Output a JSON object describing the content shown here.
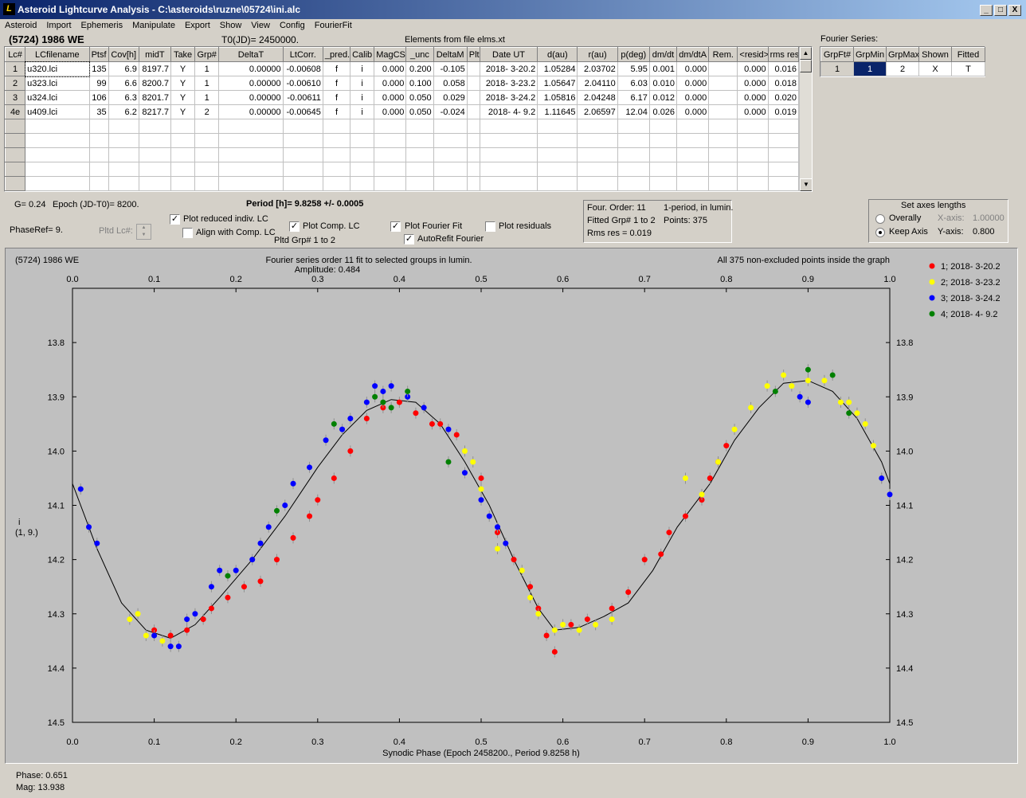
{
  "window": {
    "title": "Asteroid Lightcurve Analysis - C:\\asteroids\\ruzne\\05724\\ini.alc",
    "icon": "app-icon",
    "min": "_",
    "max": "□",
    "close": "X"
  },
  "menu": [
    "Asteroid",
    "Import",
    "Ephemeris",
    "Manipulate",
    "Export",
    "Show",
    "View",
    "Config",
    "FourierFit"
  ],
  "asteroid_name": "(5724) 1986 WE",
  "t0": "T0(JD)= 2450000.",
  "elements_note": "Elements from file elms.xt",
  "lc_table": {
    "headers": [
      "Lc#",
      "LCfilename",
      "Ptsf",
      "Cov[h]",
      "midT",
      "Take",
      "Grp#",
      "DeltaT",
      "LtCorr.",
      "_pred.",
      "Calib",
      "MagCS",
      "_unc",
      "DeltaM",
      "Plt",
      "Date UT",
      "d(au)",
      "r(au)",
      "p(deg)",
      "dm/dt",
      "dm/dtA",
      "Rem.",
      "<resid>",
      "rms res"
    ],
    "rows": [
      [
        "1",
        "u320.lci",
        "135",
        "6.9",
        "8197.7",
        "Y",
        "1",
        "0.00000",
        "-0.00608",
        "f",
        "i",
        "0.000",
        "0.200",
        "-0.105",
        "",
        "2018- 3-20.2",
        "1.05284",
        "2.03702",
        "5.95",
        "0.001",
        "0.000",
        "",
        "0.000",
        "0.016"
      ],
      [
        "2",
        "u323.lci",
        "99",
        "6.6",
        "8200.7",
        "Y",
        "1",
        "0.00000",
        "-0.00610",
        "f",
        "i",
        "0.000",
        "0.100",
        "0.058",
        "",
        "2018- 3-23.2",
        "1.05647",
        "2.04110",
        "6.03",
        "0.010",
        "0.000",
        "",
        "0.000",
        "0.018"
      ],
      [
        "3",
        "u324.lci",
        "106",
        "6.3",
        "8201.7",
        "Y",
        "1",
        "0.00000",
        "-0.00611",
        "f",
        "i",
        "0.000",
        "0.050",
        "0.029",
        "",
        "2018- 3-24.2",
        "1.05816",
        "2.04248",
        "6.17",
        "0.012",
        "0.000",
        "",
        "0.000",
        "0.020"
      ],
      [
        "4e",
        "u409.lci",
        "35",
        "6.2",
        "8217.7",
        "Y",
        "2",
        "0.00000",
        "-0.00645",
        "f",
        "i",
        "0.000",
        "0.050",
        "-0.024",
        "",
        "2018- 4- 9.2",
        "1.11645",
        "2.06597",
        "12.04",
        "0.026",
        "0.000",
        "",
        "0.000",
        "0.019"
      ]
    ]
  },
  "fourier_series": {
    "label": "Fourier Series:",
    "headers": [
      "GrpFt#",
      "GrpMin",
      "GrpMax",
      "Shown",
      "Fitted"
    ],
    "row": [
      "1",
      "1",
      "2",
      "X",
      "T"
    ]
  },
  "params": {
    "g": "G= 0.24",
    "epoch": "Epoch (JD-T0)= 8200.",
    "period": "Period [h]= 9.8258 +/- 0.0005",
    "phase_ref": "PhaseRef= 9.",
    "pltd_lc": "Pltd Lc#:",
    "pltd_grp": "Pltd Grp#  1   to   2"
  },
  "checkboxes": {
    "plot_reduced": {
      "label": "Plot reduced indiv. LC",
      "checked": true
    },
    "align_comp": {
      "label": "Align with Comp. LC",
      "checked": false
    },
    "plot_comp": {
      "label": "Plot Comp. LC",
      "checked": true
    },
    "plot_fourier": {
      "label": "Plot Fourier Fit",
      "checked": true
    },
    "plot_residuals": {
      "label": "Plot residuals",
      "checked": false
    },
    "autorefit": {
      "label": "AutoRefit Fourier",
      "checked": true
    }
  },
  "fit_info": {
    "order": "Four. Order: 11",
    "mode": "1-period, in lumin.",
    "fitted": "Fitted Grp# 1 to 2",
    "points": "Points: 375",
    "rms": "Rms res     = 0.019"
  },
  "axes_box": {
    "title": "Set axes lengths",
    "overally": "Overally",
    "keep_axis": "Keep Axis",
    "x_label": "X-axis:",
    "x_value": "1.00000",
    "y_label": "Y-axis:",
    "y_value": "0.800",
    "selected": "keep_axis"
  },
  "plot_header": {
    "left": "(5724) 1986 WE",
    "center1": "Fourier series order 11 fit to selected groups in lumin.",
    "center2": "Amplitude: 0.484",
    "right": "All 375 non-excluded points inside the graph"
  },
  "legend": [
    {
      "label": "1; 2018- 3-20.2",
      "color": "#ff0000"
    },
    {
      "label": "2; 2018- 3-23.2",
      "color": "#ffff00"
    },
    {
      "label": "3; 2018- 3-24.2",
      "color": "#0000ff"
    },
    {
      "label": "4; 2018- 4- 9.2",
      "color": "#008000"
    }
  ],
  "status": {
    "phase": "Phase:  0.651",
    "mag": "Mag:    13.938"
  },
  "chart_data": {
    "type": "scatter",
    "xlabel": "Synodic Phase (Epoch 2458200., Period 9.8258 h)",
    "ylabel_lines": [
      "i",
      "(1, 9.)"
    ],
    "xlim": [
      0.0,
      1.0
    ],
    "ylim": [
      14.5,
      13.7
    ],
    "inverted_y": true,
    "x_ticks": [
      "0.0",
      "0.1",
      "0.2",
      "0.3",
      "0.4",
      "0.5",
      "0.6",
      "0.7",
      "0.8",
      "0.9",
      "1.0"
    ],
    "y_ticks": [
      "13.8",
      "13.9",
      "14.0",
      "14.1",
      "14.2",
      "14.3",
      "14.4",
      "14.5"
    ],
    "fit_curve": [
      [
        0.0,
        14.06
      ],
      [
        0.03,
        14.18
      ],
      [
        0.06,
        14.28
      ],
      [
        0.09,
        14.33
      ],
      [
        0.12,
        14.345
      ],
      [
        0.15,
        14.32
      ],
      [
        0.18,
        14.27
      ],
      [
        0.22,
        14.2
      ],
      [
        0.26,
        14.12
      ],
      [
        0.3,
        14.03
      ],
      [
        0.33,
        13.97
      ],
      [
        0.36,
        13.925
      ],
      [
        0.39,
        13.905
      ],
      [
        0.42,
        13.91
      ],
      [
        0.45,
        13.95
      ],
      [
        0.48,
        14.02
      ],
      [
        0.51,
        14.1
      ],
      [
        0.54,
        14.2
      ],
      [
        0.57,
        14.29
      ],
      [
        0.59,
        14.33
      ],
      [
        0.62,
        14.325
      ],
      [
        0.65,
        14.305
      ],
      [
        0.68,
        14.28
      ],
      [
        0.71,
        14.22
      ],
      [
        0.74,
        14.14
      ],
      [
        0.78,
        14.06
      ],
      [
        0.81,
        13.98
      ],
      [
        0.84,
        13.92
      ],
      [
        0.87,
        13.875
      ],
      [
        0.9,
        13.87
      ],
      [
        0.93,
        13.89
      ],
      [
        0.96,
        13.94
      ],
      [
        0.99,
        14.02
      ],
      [
        1.0,
        14.06
      ]
    ],
    "series": [
      {
        "name": "1; 2018- 3-20.2",
        "color": "#ff0000",
        "points": [
          [
            0.1,
            14.33
          ],
          [
            0.12,
            14.34
          ],
          [
            0.14,
            14.33
          ],
          [
            0.16,
            14.31
          ],
          [
            0.17,
            14.29
          ],
          [
            0.19,
            14.27
          ],
          [
            0.21,
            14.25
          ],
          [
            0.23,
            14.24
          ],
          [
            0.25,
            14.2
          ],
          [
            0.27,
            14.16
          ],
          [
            0.29,
            14.12
          ],
          [
            0.3,
            14.09
          ],
          [
            0.32,
            14.05
          ],
          [
            0.34,
            14.0
          ],
          [
            0.36,
            13.94
          ],
          [
            0.38,
            13.92
          ],
          [
            0.4,
            13.91
          ],
          [
            0.42,
            13.93
          ],
          [
            0.44,
            13.95
          ],
          [
            0.45,
            13.95
          ],
          [
            0.47,
            13.97
          ],
          [
            0.5,
            14.05
          ],
          [
            0.52,
            14.15
          ],
          [
            0.54,
            14.2
          ],
          [
            0.56,
            14.25
          ],
          [
            0.57,
            14.29
          ],
          [
            0.58,
            14.34
          ],
          [
            0.59,
            14.37
          ],
          [
            0.61,
            14.32
          ],
          [
            0.63,
            14.31
          ],
          [
            0.66,
            14.29
          ],
          [
            0.68,
            14.26
          ],
          [
            0.7,
            14.2
          ],
          [
            0.72,
            14.19
          ],
          [
            0.73,
            14.15
          ],
          [
            0.75,
            14.12
          ],
          [
            0.77,
            14.09
          ],
          [
            0.78,
            14.05
          ],
          [
            0.79,
            14.02
          ],
          [
            0.8,
            13.99
          ]
        ]
      },
      {
        "name": "2; 2018- 3-23.2",
        "color": "#ffff00",
        "points": [
          [
            0.07,
            14.31
          ],
          [
            0.08,
            14.3
          ],
          [
            0.09,
            14.34
          ],
          [
            0.11,
            14.35
          ],
          [
            0.48,
            14.0
          ],
          [
            0.49,
            14.02
          ],
          [
            0.5,
            14.07
          ],
          [
            0.52,
            14.18
          ],
          [
            0.55,
            14.22
          ],
          [
            0.56,
            14.27
          ],
          [
            0.57,
            14.3
          ],
          [
            0.59,
            14.33
          ],
          [
            0.6,
            14.32
          ],
          [
            0.62,
            14.33
          ],
          [
            0.64,
            14.32
          ],
          [
            0.66,
            14.31
          ],
          [
            0.75,
            14.05
          ],
          [
            0.77,
            14.08
          ],
          [
            0.79,
            14.02
          ],
          [
            0.81,
            13.96
          ],
          [
            0.83,
            13.92
          ],
          [
            0.85,
            13.88
          ],
          [
            0.87,
            13.86
          ],
          [
            0.88,
            13.88
          ],
          [
            0.9,
            13.87
          ],
          [
            0.92,
            13.87
          ],
          [
            0.94,
            13.91
          ],
          [
            0.95,
            13.91
          ],
          [
            0.96,
            13.93
          ],
          [
            0.97,
            13.95
          ],
          [
            0.98,
            13.99
          ],
          [
            0.99,
            14.05
          ]
        ]
      },
      {
        "name": "3; 2018- 3-24.2",
        "color": "#0000ff",
        "points": [
          [
            0.01,
            14.07
          ],
          [
            0.02,
            14.14
          ],
          [
            0.03,
            14.17
          ],
          [
            0.1,
            14.34
          ],
          [
            0.12,
            14.36
          ],
          [
            0.13,
            14.36
          ],
          [
            0.14,
            14.31
          ],
          [
            0.15,
            14.3
          ],
          [
            0.17,
            14.25
          ],
          [
            0.18,
            14.22
          ],
          [
            0.2,
            14.22
          ],
          [
            0.22,
            14.2
          ],
          [
            0.23,
            14.17
          ],
          [
            0.24,
            14.14
          ],
          [
            0.26,
            14.1
          ],
          [
            0.27,
            14.06
          ],
          [
            0.29,
            14.03
          ],
          [
            0.31,
            13.98
          ],
          [
            0.33,
            13.96
          ],
          [
            0.34,
            13.94
          ],
          [
            0.36,
            13.91
          ],
          [
            0.37,
            13.88
          ],
          [
            0.38,
            13.89
          ],
          [
            0.39,
            13.88
          ],
          [
            0.41,
            13.9
          ],
          [
            0.43,
            13.92
          ],
          [
            0.46,
            13.96
          ],
          [
            0.48,
            14.04
          ],
          [
            0.5,
            14.09
          ],
          [
            0.51,
            14.12
          ],
          [
            0.52,
            14.14
          ],
          [
            0.53,
            14.17
          ],
          [
            0.89,
            13.9
          ],
          [
            0.9,
            13.91
          ],
          [
            0.99,
            14.05
          ],
          [
            1.0,
            14.08
          ]
        ]
      },
      {
        "name": "4; 2018- 4- 9.2",
        "color": "#008000",
        "points": [
          [
            0.19,
            14.23
          ],
          [
            0.25,
            14.11
          ],
          [
            0.32,
            13.95
          ],
          [
            0.37,
            13.9
          ],
          [
            0.38,
            13.91
          ],
          [
            0.39,
            13.92
          ],
          [
            0.41,
            13.89
          ],
          [
            0.46,
            14.02
          ],
          [
            0.86,
            13.89
          ],
          [
            0.9,
            13.85
          ],
          [
            0.93,
            13.86
          ],
          [
            0.95,
            13.93
          ]
        ]
      }
    ]
  }
}
